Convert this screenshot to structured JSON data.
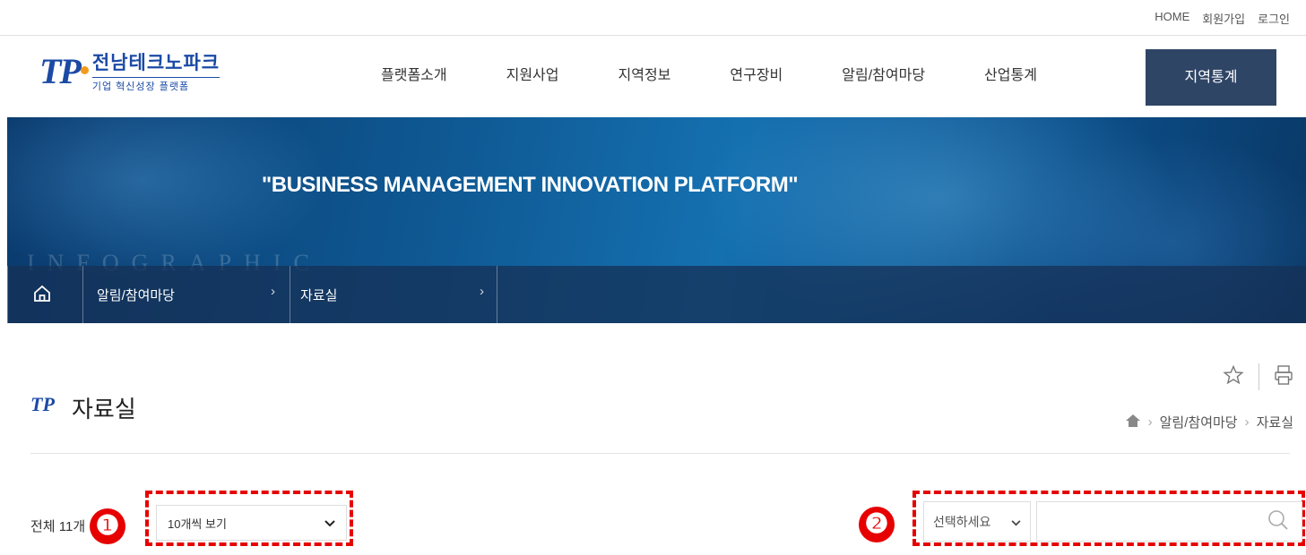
{
  "util_links": [
    "HOME",
    "회원가입",
    "로그인"
  ],
  "logo": {
    "mark": "TP",
    "title": "전남테크노파크",
    "subtitle": "기업 혁신성장 플랫폼"
  },
  "gnb": [
    "플랫폼소개",
    "지원사업",
    "지역정보",
    "연구장비",
    "알림/참여마당",
    "산업통계"
  ],
  "gnb_active": "지역통계",
  "banner": {
    "slogan": "\"BUSINESS MANAGEMENT INNOVATION PLATFORM\"",
    "watermark": "INFOGRAPHIC",
    "crumbs": [
      "알림/참여마당",
      "자료실"
    ]
  },
  "page": {
    "title": "자료실",
    "location": [
      "알림/참여마당",
      "자료실"
    ]
  },
  "list": {
    "total_label": "전체 11",
    "total_suffix": "개",
    "page_size": "10개씩 보기",
    "search_field": "선택하세요",
    "search_placeholder": ""
  },
  "annotations": [
    "❶",
    "❷"
  ],
  "colors": {
    "brand": "#1b4aa5",
    "nav_active": "#2f4566",
    "annotation": "#e60000"
  }
}
